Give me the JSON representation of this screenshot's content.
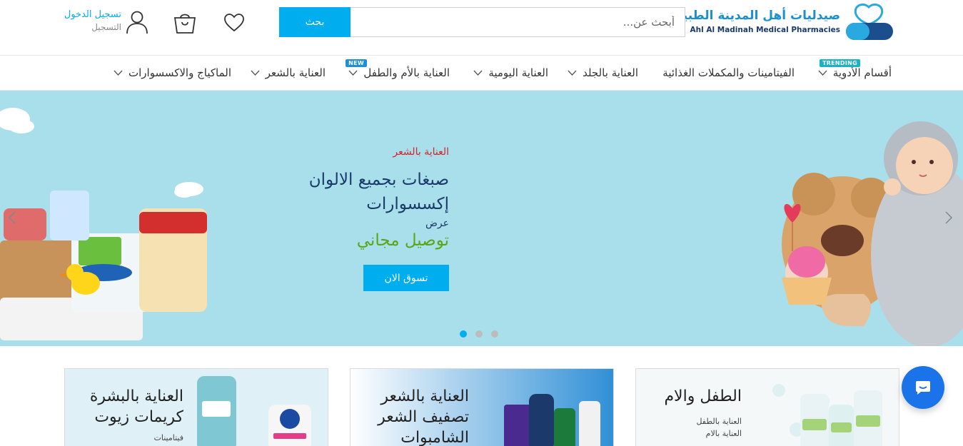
{
  "header": {
    "logo_ar": "صيدليات أهل المدينة الطبية",
    "logo_en": "Ahl Al Madinah Medical Pharmacies",
    "search_placeholder": "أبحث عن...",
    "search_button": "بحث",
    "login_primary": "تسجيل الدخول",
    "login_secondary": "التسجيل",
    "icons": [
      "heart-icon",
      "shopping-bag-icon",
      "user-icon"
    ]
  },
  "nav": {
    "items": [
      {
        "label": "أقسام الأدوية",
        "tag": "TRENDING",
        "has_dropdown": true
      },
      {
        "label": "الفيتامينات والمكملات الغذائية",
        "has_dropdown": false
      },
      {
        "label": "العناية بالجلد",
        "has_dropdown": true
      },
      {
        "label": "العناية اليومية",
        "has_dropdown": true
      },
      {
        "label": "العناية بالأم والطفل",
        "tag": "NEW",
        "has_dropdown": true
      },
      {
        "label": "العناية بالشعر",
        "has_dropdown": true
      },
      {
        "label": "الماكياج والاكسسوارات",
        "has_dropdown": true
      }
    ]
  },
  "hero": {
    "category": "العناية بالشعر",
    "title_line1": "صبغات بجميع الالوان",
    "title_line2": "إكسسوارات",
    "offer_label": "عرض",
    "offer_text": "توصيل مجاني",
    "cta": "تسوق الان",
    "slides": 3,
    "active_slide": 1,
    "colors": {
      "accent": "#00aeef",
      "background": "#a8dfea",
      "category": "#d8232a",
      "offer": "#58a618",
      "title": "#1b3a6b"
    }
  },
  "cards": [
    {
      "title_lines": [
        "الطفل والام"
      ],
      "links": [
        "العناية بالطفل",
        "العناية بالام"
      ]
    },
    {
      "title_lines": [
        "العناية بالشعر",
        "تصفيف الشعر",
        "الشامبوات"
      ],
      "links": []
    },
    {
      "title_lines": [
        "العناية بالبشرة",
        "كريمات زيوت"
      ],
      "links": [
        "فيتامينات"
      ]
    }
  ],
  "chat": {
    "icon": "chat-bubble-icon"
  }
}
